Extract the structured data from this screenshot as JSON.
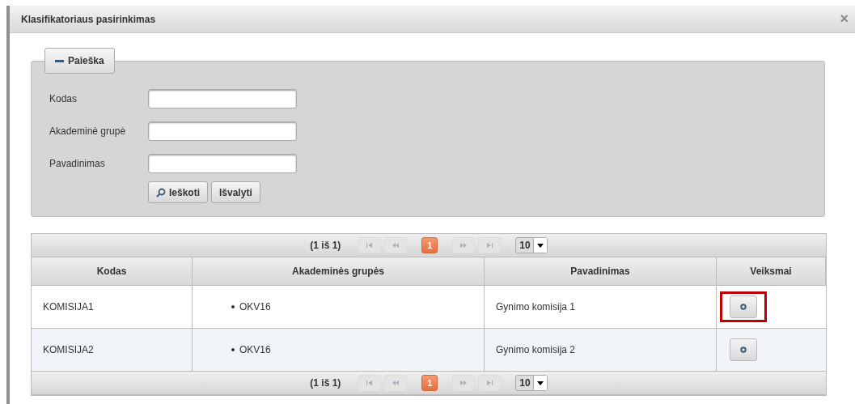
{
  "window": {
    "title": "Klasifikatoriaus pasirinkimas",
    "close": "×"
  },
  "search_panel": {
    "legend": "Paieška",
    "expanded": true,
    "fields": [
      {
        "label": "Kodas"
      },
      {
        "label": "Akademinė grupė"
      },
      {
        "label": "Pavadinimas"
      }
    ],
    "buttons": [
      {
        "kind": "search",
        "label": "Ieškoti"
      },
      {
        "kind": "plain",
        "label": "Išvalyti"
      }
    ]
  },
  "table": {
    "paginator_top": {
      "info": "(1 iš 1)",
      "pages": [
        {
          "label": "1",
          "selected": true
        }
      ],
      "rows_per_page": "10"
    },
    "columns": [
      "Kodas",
      "Akademinės grupės",
      "Pavadinimas",
      "Veiksmai"
    ],
    "rows": [
      {
        "code": "KOMISIJA1",
        "groups": [
          "OKV16"
        ],
        "name": "Gynimo komisija 1",
        "highlighted": true
      },
      {
        "code": "KOMISIJA2",
        "groups": [
          "OKV16"
        ],
        "name": "Gynimo komisija 2",
        "highlighted": false
      }
    ],
    "paginator_bottom": {
      "info": "(1 iš 1)",
      "pages": [
        {
          "label": "1",
          "selected": true
        }
      ],
      "rows_per_page": "10"
    }
  }
}
